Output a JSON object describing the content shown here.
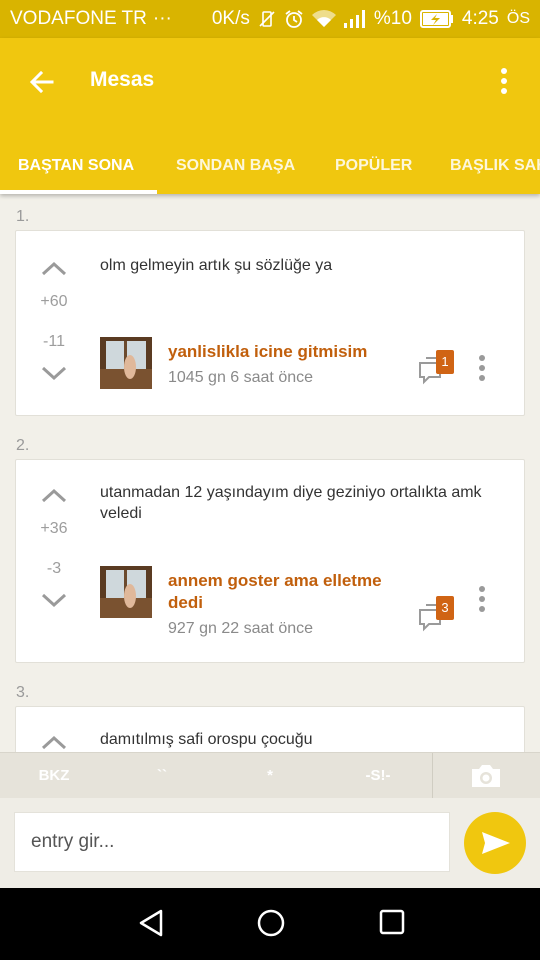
{
  "status_bar": {
    "carrier": "VODAFONE TR",
    "dots": "···",
    "speed": "0K/s",
    "battery_pct": "%10",
    "time": "4:25",
    "ampm": "ÖS"
  },
  "app_bar": {
    "title": "Mesas",
    "back_icon": "arrow-left-icon",
    "menu_icon": "more-vert-icon"
  },
  "tabs": [
    {
      "label": "BAŞTAN SONA",
      "active": true
    },
    {
      "label": "SONDAN BAŞA",
      "active": false
    },
    {
      "label": "POPÜLER",
      "active": false
    },
    {
      "label": "BAŞLIK SAHİBİ",
      "active": false
    }
  ],
  "entries": [
    {
      "number": "1.",
      "text": "olm gelmeyin artık şu sözlüğe ya",
      "upvotes": "+60",
      "downvotes": "-11",
      "author": "yanlislikla icine gitmisim",
      "time": "1045 gn 6 saat  önce",
      "comments": "1"
    },
    {
      "number": "2.",
      "text": "utanmadan 12 yaşındayım diye geziniyo ortalıkta amk veledi",
      "upvotes": "+36",
      "downvotes": "-3",
      "author": "annem goster ama elletme dedi",
      "time": "927 gn 22 saat  önce",
      "comments": "3"
    },
    {
      "number": "3.",
      "text": "damıtılmış safi orospu çocuğu"
    }
  ],
  "toolbar": {
    "bkz": "BKZ",
    "backtick": "``",
    "star": "*",
    "spoiler": "-S!-",
    "camera_icon": "camera-icon"
  },
  "input": {
    "placeholder": "entry gir...",
    "send_icon": "send-icon"
  },
  "colors": {
    "primary": "#f0c70f",
    "status": "#d9b400",
    "author": "#c15f0c",
    "badge": "#d06414"
  }
}
